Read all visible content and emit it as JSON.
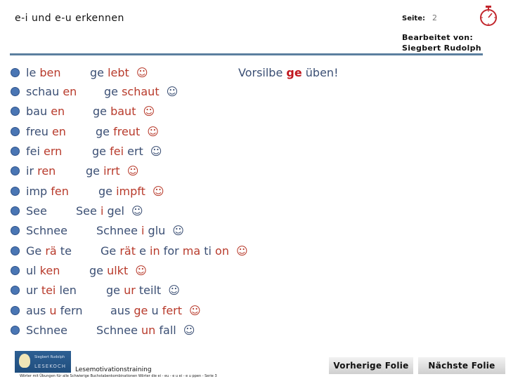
{
  "header": {
    "title": "e-i und e-u erkennen",
    "page_label": "Seite:",
    "page_number": "2",
    "edited_by_label": "Bearbeitet von:",
    "author": "Siegbert Rudolph"
  },
  "heading": {
    "prefix": "Vorsilbe ",
    "highlight": "ge",
    "suffix": " üben!"
  },
  "colors": {
    "text": "#3b4f74",
    "highlight": "#b83b2c",
    "bullet": "#4a76b4",
    "rule": "#5b7f9f"
  },
  "rows": [
    {
      "left": [
        {
          "t": "le ",
          "h": false
        },
        {
          "t": "ben",
          "h": true
        }
      ],
      "right": [
        {
          "t": "ge ",
          "h": false
        },
        {
          "t": "lebt",
          "h": true
        }
      ],
      "smile": "☺",
      "smile_red": true
    },
    {
      "left": [
        {
          "t": "schau ",
          "h": false
        },
        {
          "t": "en",
          "h": true
        }
      ],
      "right": [
        {
          "t": "ge ",
          "h": false
        },
        {
          "t": "schaut",
          "h": true
        }
      ],
      "smile": "☺",
      "smile_red": false
    },
    {
      "left": [
        {
          "t": "bau ",
          "h": false
        },
        {
          "t": "en",
          "h": true
        }
      ],
      "right": [
        {
          "t": "ge ",
          "h": false
        },
        {
          "t": "baut",
          "h": true
        }
      ],
      "smile": "☺",
      "smile_red": true
    },
    {
      "left": [
        {
          "t": "freu ",
          "h": false
        },
        {
          "t": "en",
          "h": true
        }
      ],
      "right": [
        {
          "t": "ge ",
          "h": false
        },
        {
          "t": "freut",
          "h": true
        }
      ],
      "smile": "☺",
      "smile_red": true
    },
    {
      "left": [
        {
          "t": "fei ",
          "h": false
        },
        {
          "t": "ern",
          "h": true
        }
      ],
      "right": [
        {
          "t": "ge ",
          "h": false
        },
        {
          "t": "fei",
          "h": true
        },
        {
          "t": " ert",
          "h": false
        }
      ],
      "smile": "☺",
      "smile_red": false
    },
    {
      "left": [
        {
          "t": "ir ",
          "h": false
        },
        {
          "t": "ren",
          "h": true
        }
      ],
      "right": [
        {
          "t": "ge ",
          "h": false
        },
        {
          "t": "irrt",
          "h": true
        }
      ],
      "smile": "☺",
      "smile_red": true
    },
    {
      "left": [
        {
          "t": "imp ",
          "h": false
        },
        {
          "t": "fen",
          "h": true
        }
      ],
      "right": [
        {
          "t": "ge ",
          "h": false
        },
        {
          "t": "impft",
          "h": true
        }
      ],
      "smile": "☺",
      "smile_red": true
    },
    {
      "left": [
        {
          "t": "See",
          "h": false
        }
      ],
      "right": [
        {
          "t": "See ",
          "h": false
        },
        {
          "t": "i",
          "h": true
        },
        {
          "t": " gel",
          "h": false
        }
      ],
      "smile": "☺",
      "smile_red": false
    },
    {
      "left": [
        {
          "t": "Schnee",
          "h": false
        }
      ],
      "right": [
        {
          "t": "Schnee ",
          "h": false
        },
        {
          "t": "i",
          "h": true
        },
        {
          "t": " glu",
          "h": false
        }
      ],
      "smile": "☺",
      "smile_red": false
    },
    {
      "left": [
        {
          "t": "Ge ",
          "h": false
        },
        {
          "t": "rä",
          "h": true
        },
        {
          "t": " te",
          "h": false
        }
      ],
      "right": [
        {
          "t": "Ge ",
          "h": false
        },
        {
          "t": "rät",
          "h": true
        },
        {
          "t": " e ",
          "h": false
        },
        {
          "t": "in",
          "h": true
        },
        {
          "t": " for ",
          "h": false
        },
        {
          "t": "ma",
          "h": true
        },
        {
          "t": " ti ",
          "h": false
        },
        {
          "t": "on",
          "h": true
        }
      ],
      "smile": "☺",
      "smile_red": true
    },
    {
      "left": [
        {
          "t": "ul ",
          "h": false
        },
        {
          "t": "ken",
          "h": true
        }
      ],
      "right": [
        {
          "t": "ge ",
          "h": false
        },
        {
          "t": "ulkt",
          "h": true
        }
      ],
      "smile": "☺",
      "smile_red": true
    },
    {
      "left": [
        {
          "t": "ur ",
          "h": false
        },
        {
          "t": "tei",
          "h": true
        },
        {
          "t": " len",
          "h": false
        }
      ],
      "right": [
        {
          "t": "ge ",
          "h": false
        },
        {
          "t": "ur",
          "h": true
        },
        {
          "t": " teilt",
          "h": false
        }
      ],
      "smile": "☺",
      "smile_red": false
    },
    {
      "left": [
        {
          "t": "aus ",
          "h": false
        },
        {
          "t": "u",
          "h": true
        },
        {
          "t": " fern",
          "h": false
        }
      ],
      "right": [
        {
          "t": "aus ",
          "h": false
        },
        {
          "t": "ge",
          "h": true
        },
        {
          "t": " u ",
          "h": false
        },
        {
          "t": "fert",
          "h": true
        }
      ],
      "smile": "☺",
      "smile_red": true
    },
    {
      "left": [
        {
          "t": "Schnee",
          "h": false
        }
      ],
      "right": [
        {
          "t": "Schnee ",
          "h": false
        },
        {
          "t": "un",
          "h": true
        },
        {
          "t": " fall",
          "h": false
        }
      ],
      "smile": "☺",
      "smile_red": false
    }
  ],
  "footer": {
    "logo_line1": "Siegbert Rudolph",
    "logo_line2": "LESEKOCH",
    "program": "Lesemotivationstraining",
    "caption": "Wörter mit Übungen für alle Schwierige Buchstabenkombinationen Wörter die ei - eu - e u ei - e u ppen - Serie 3"
  },
  "nav": {
    "prev_label": "Vorherige Folie",
    "next_label": "Nächste Folie"
  }
}
